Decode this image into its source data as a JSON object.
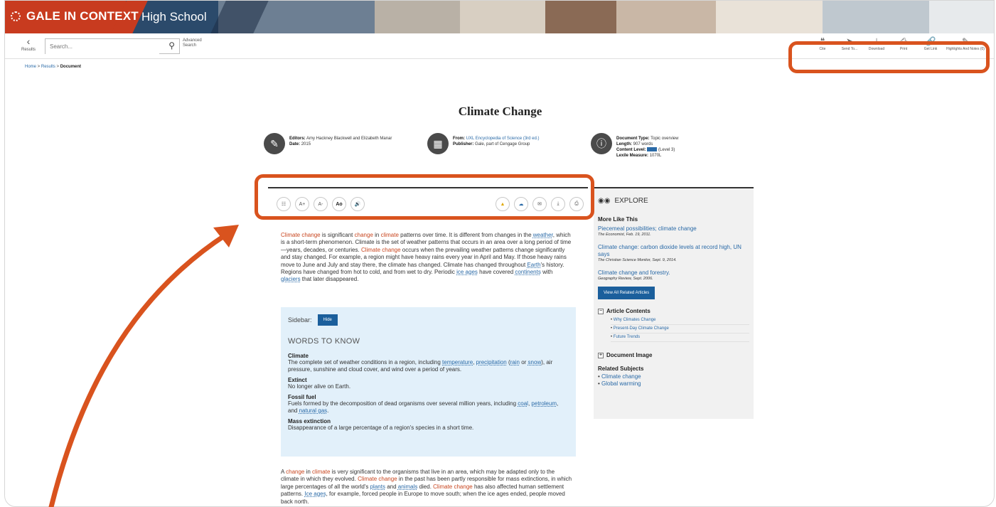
{
  "header": {
    "brand": "GALE IN CONTEXT",
    "edition": "High School"
  },
  "toolbar": {
    "back_label": "Results",
    "search_placeholder": "Search...",
    "advanced_search": "Advanced Search",
    "tools": [
      {
        "label": "Cite",
        "icon": "cite-icon"
      },
      {
        "label": "Send To...",
        "icon": "send-icon"
      },
      {
        "label": "Download",
        "icon": "download-icon"
      },
      {
        "label": "Print",
        "icon": "print-icon"
      },
      {
        "label": "Get Link",
        "icon": "link-icon"
      },
      {
        "label": "Highlights And Notes (0)",
        "icon": "highlighter-icon"
      }
    ]
  },
  "breadcrumb": {
    "home": "Home",
    "results": "Results",
    "current": "Document"
  },
  "document": {
    "title": "Climate Change",
    "editors_label": "Editors:",
    "editors": "Amy Hackney Blackwell and Elizabeth Manar",
    "date_label": "Date:",
    "date": "2015",
    "from_label": "From:",
    "from": "UXL Encyclopedia of Science (3rd ed.)",
    "publisher_label": "Publisher:",
    "publisher": "Gale, part of Cengage Group",
    "doctype_label": "Document Type:",
    "doctype": "Topic overview",
    "length_label": "Length:",
    "length": "907 words",
    "content_level_label": "Content Level:",
    "content_level": "(Level 3)",
    "lexile_label": "Lexile Measure:",
    "lexile": "1070L"
  },
  "article_tools": {
    "left": [
      "Translate",
      "A+",
      "A-",
      "Ao",
      "Listen"
    ],
    "right": [
      "Google Drive",
      "OneDrive",
      "Email",
      "Download",
      "Print"
    ]
  },
  "article": {
    "p1": [
      {
        "t": "Climate",
        "c": "w"
      },
      {
        "t": " "
      },
      {
        "t": "change",
        "c": "w"
      },
      {
        "t": " is significant "
      },
      {
        "t": "change",
        "c": "w"
      },
      {
        "t": " in "
      },
      {
        "t": "climate",
        "c": "w"
      },
      {
        "t": " patterns over time. It is different from changes in the "
      },
      {
        "t": "weather",
        "c": "lk"
      },
      {
        "t": ", which is a short-term phenomenon. Climate is the set of weather patterns that occurs in an area over a long period of time—years, decades, or centuries. "
      },
      {
        "t": "Climate change",
        "c": "w"
      },
      {
        "t": " occurs when the prevailing weather patterns change significantly and stay changed. For example, a region might have heavy rains every year in April and May. If those heavy rains move to June and July and stay there, the climate has changed. Climate has changed throughout "
      },
      {
        "t": "Earth",
        "c": "lk"
      },
      {
        "t": "'s history. Regions have changed from hot to cold, and from wet to dry. Periodic "
      },
      {
        "t": "ice ages",
        "c": "lk"
      },
      {
        "t": " have covered "
      },
      {
        "t": "continents",
        "c": "lk"
      },
      {
        "t": " with "
      },
      {
        "t": "glaciers",
        "c": "lk"
      },
      {
        "t": " that later disappeared."
      }
    ],
    "p2": [
      {
        "t": "A "
      },
      {
        "t": "change",
        "c": "w"
      },
      {
        "t": " in "
      },
      {
        "t": "climate",
        "c": "w"
      },
      {
        "t": " is very significant to the organisms that live in an area, which may be adapted only to the climate in which they evolved. "
      },
      {
        "t": "Climate change",
        "c": "w"
      },
      {
        "t": " in the past has been partly responsible for mass extinctions, in which large percentages of all the world's "
      },
      {
        "t": "plants",
        "c": "lk"
      },
      {
        "t": " and "
      },
      {
        "t": "animals",
        "c": "lk"
      },
      {
        "t": " died. "
      },
      {
        "t": "Climate change",
        "c": "w"
      },
      {
        "t": " has also affected human settlement patterns. "
      },
      {
        "t": "Ice ages",
        "c": "lk"
      },
      {
        "t": ", for example, forced people in Europe to move south; when the ice ages ended, people moved back north."
      }
    ]
  },
  "sidebar": {
    "label": "Sidebar:",
    "hide_button": "Hide",
    "heading": "WORDS TO KNOW",
    "terms": [
      {
        "term": "Climate",
        "def": [
          {
            "t": "The complete set of weather conditions in a region, including "
          },
          {
            "t": "temperature",
            "c": "lk"
          },
          {
            "t": ", "
          },
          {
            "t": "precipitation",
            "c": "lk"
          },
          {
            "t": " ("
          },
          {
            "t": "rain",
            "c": "lk"
          },
          {
            "t": " or "
          },
          {
            "t": "snow",
            "c": "lk"
          },
          {
            "t": "), air pressure, sunshine and cloud cover, and wind over a period of years."
          }
        ]
      },
      {
        "term": "Extinct",
        "def": [
          {
            "t": "No longer alive on Earth."
          }
        ]
      },
      {
        "term": "Fossil fuel",
        "def": [
          {
            "t": "Fuels formed by the decomposition of dead organisms over several million years, including "
          },
          {
            "t": "coal",
            "c": "lk"
          },
          {
            "t": ", "
          },
          {
            "t": "petroleum",
            "c": "lk"
          },
          {
            "t": ", and "
          },
          {
            "t": "natural gas",
            "c": "lk"
          },
          {
            "t": "."
          }
        ]
      },
      {
        "term": "Mass extinction",
        "def": [
          {
            "t": "Disappearance of a large percentage of a region's species in a short time."
          }
        ]
      }
    ]
  },
  "explore": {
    "title": "EXPLORE",
    "more_like_this": "More Like This",
    "items": [
      {
        "title": "Piecemeal possibilities; climate change",
        "source": "The Economist, Feb. 19, 2011."
      },
      {
        "title": "Climate change: carbon dioxide levels at record high, UN says",
        "source": "The Christian Science Monitor, Sept. 9, 2014."
      },
      {
        "title": "Climate change and forestry.",
        "source": "Geography Review, Sept. 2006."
      }
    ],
    "view_all": "View All Related Articles",
    "article_contents": "Article Contents",
    "contents": [
      "Why Climates Change",
      "Present-Day Climate Change",
      "Future Trends"
    ],
    "document_image": "Document Image",
    "related_subjects": "Related Subjects",
    "subjects": [
      "Climate change",
      "Global warming"
    ]
  },
  "colors": {
    "brand_red": "#c83b1f",
    "annotation_orange": "#d9531e",
    "link_blue": "#2a6aa7",
    "button_blue": "#1b5f9c",
    "sidebar_bg": "#e2f0fa"
  }
}
